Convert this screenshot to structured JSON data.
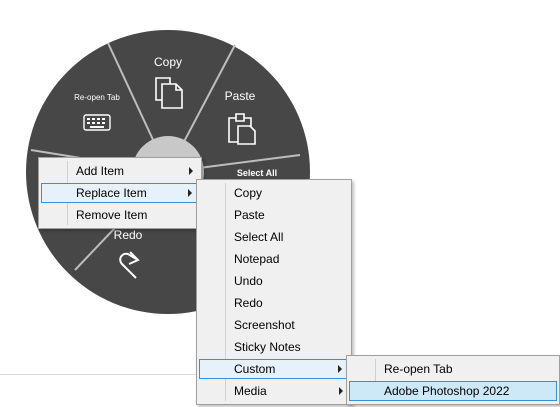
{
  "wheel": {
    "segments": {
      "copy": "Copy",
      "paste": "Paste",
      "select_all": "Select All",
      "reopen_tab": "Re-open Tab",
      "redo": "Redo"
    },
    "colors": {
      "segment": "#474747",
      "divider": "#bdbdbd",
      "center": "#c8c8c8",
      "icon": "#ffffff"
    }
  },
  "context_menu": {
    "items": [
      {
        "label": "Add Item"
      },
      {
        "label": "Replace Item"
      },
      {
        "label": "Remove Item"
      }
    ]
  },
  "submenu": {
    "items": [
      {
        "label": "Copy"
      },
      {
        "label": "Paste"
      },
      {
        "label": "Select All"
      },
      {
        "label": "Notepad"
      },
      {
        "label": "Undo"
      },
      {
        "label": "Redo"
      },
      {
        "label": "Screenshot"
      },
      {
        "label": "Sticky Notes"
      },
      {
        "label": "Custom"
      },
      {
        "label": "Media"
      }
    ]
  },
  "custom_submenu": {
    "items": [
      {
        "label": "Re-open Tab"
      },
      {
        "label": "Adobe Photoshop 2022"
      }
    ]
  },
  "highlight_color": "#3a8fd0"
}
